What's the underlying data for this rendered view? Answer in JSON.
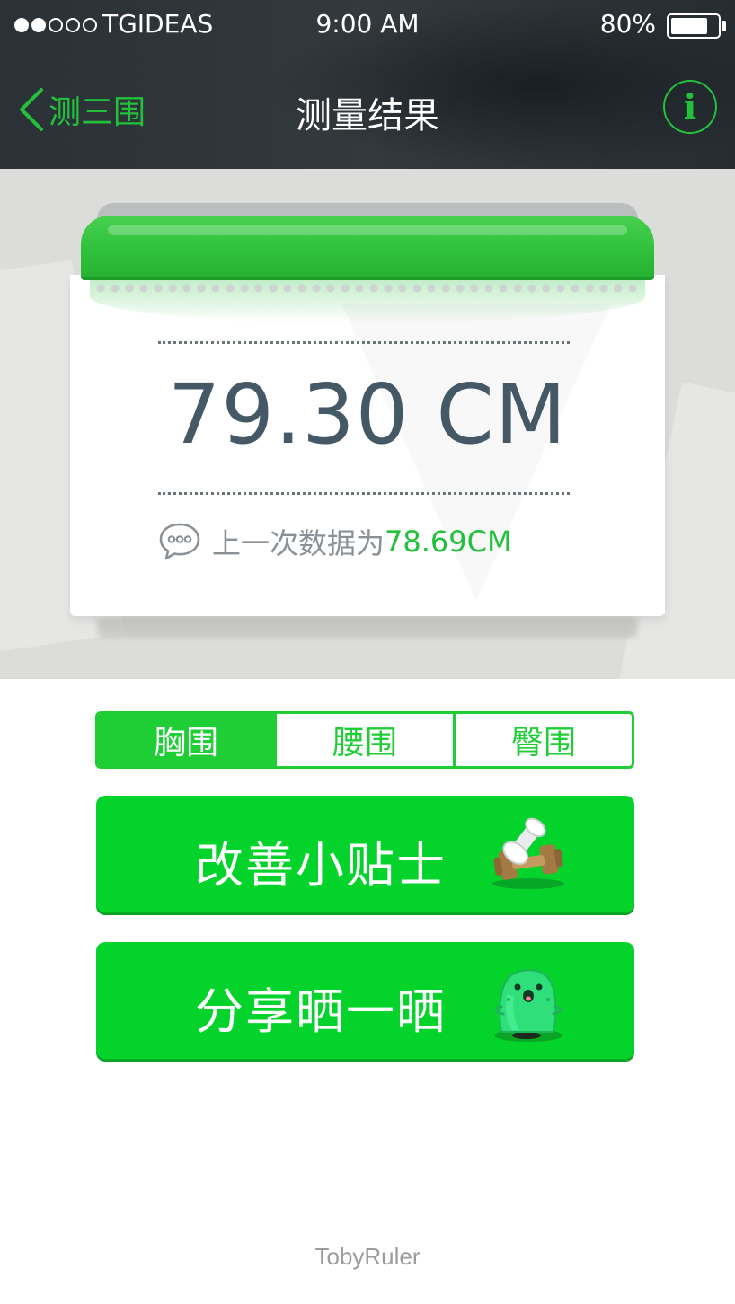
{
  "status_bar": {
    "signal_strength": 2,
    "signal_max": 5,
    "carrier": "TGIDEAS",
    "time": "9:00 AM",
    "battery": "80%",
    "battery_level": 0.8
  },
  "nav": {
    "back_label": "测三围",
    "title": "测量结果",
    "info_icon": "i"
  },
  "result": {
    "measurement": "79.30 CM",
    "previous_prefix": "上一次数据为",
    "previous_value": "78.69CM",
    "chat_icon": "speech-bubble-icon"
  },
  "tabs": [
    {
      "label": "胸围",
      "active": true
    },
    {
      "label": "腰围",
      "active": false
    },
    {
      "label": "臀围",
      "active": false
    }
  ],
  "actions": {
    "tips_label": "改善小贴士",
    "tips_icon": "dumbbell-icon",
    "share_label": "分享晒一晒",
    "share_icon": "green-mascot-icon"
  },
  "footer": {
    "brand": "TobyRuler"
  },
  "colors": {
    "accent": "#23c03b",
    "button_green": "#03d32b",
    "header_dark": "#2f3639",
    "measurement_text": "#445866"
  }
}
